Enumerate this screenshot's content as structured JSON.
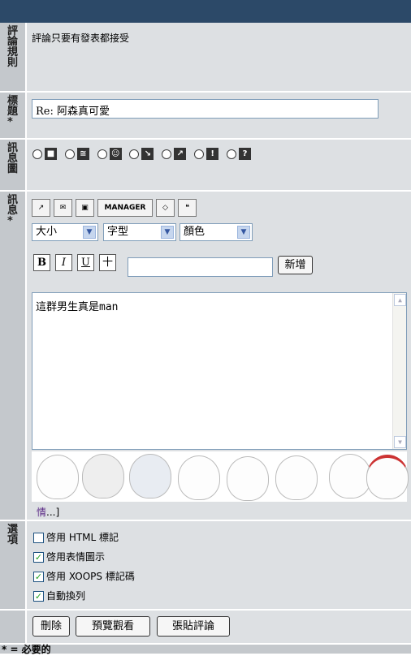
{
  "rules": {
    "label": [
      "評",
      "論",
      "規",
      "則"
    ],
    "text": "評論只要有發表都接受"
  },
  "title_field": {
    "label": [
      "標",
      "題",
      "*"
    ],
    "value": "Re: 阿森真可愛"
  },
  "icon_field": {
    "label": [
      "訊",
      "息",
      "圖"
    ],
    "icons": [
      "■",
      "≅",
      "☺",
      "↘",
      "↗",
      "!",
      "?"
    ]
  },
  "message_field": {
    "label": [
      "訊",
      "息",
      "*"
    ],
    "toolbar": {
      "manager_label": "MANAGER"
    },
    "selects": {
      "size": "大小",
      "font": "字型",
      "color": "顏色"
    },
    "format_buttons": {
      "bold": "B",
      "italic": "I",
      "underline": "U",
      "strike": "十"
    },
    "add_button": "新增",
    "body": "這群男生真是man",
    "more_link": "情",
    "more_tail": "...]"
  },
  "options": {
    "label": [
      "選",
      "項"
    ],
    "items": [
      {
        "label": "啓用 HTML 標記",
        "checked": false
      },
      {
        "label": "啓用表情圖示",
        "checked": true
      },
      {
        "label": "啓用 XOOPS 標記碼",
        "checked": true
      },
      {
        "label": "自動換列",
        "checked": true
      }
    ]
  },
  "buttons": {
    "delete": "刪除",
    "preview": "預覽觀看",
    "post": "張貼評論"
  },
  "footer": {
    "required_note": "* = 必要的"
  },
  "colors": {
    "header": "#2c4968",
    "label_bg": "#c4c8cc",
    "content_bg": "#dde0e3"
  }
}
